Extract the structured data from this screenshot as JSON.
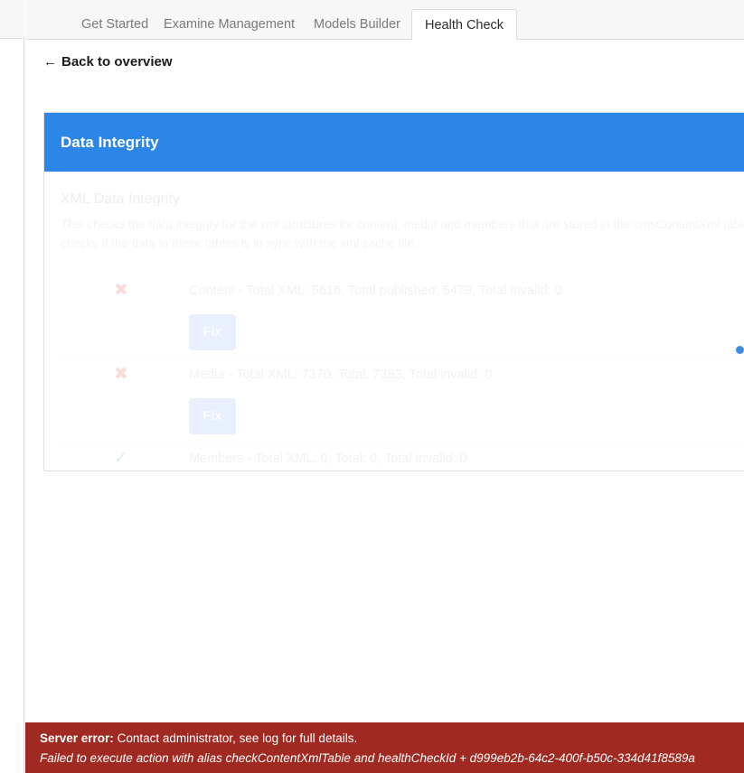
{
  "tabs": [
    {
      "label": "Get Started",
      "active": false
    },
    {
      "label": "Examine Management",
      "active": false
    },
    {
      "label": "Models Builder",
      "active": false
    },
    {
      "label": "Health Check",
      "active": true
    }
  ],
  "back_link": {
    "arrow": "←",
    "label": "Back to overview"
  },
  "card": {
    "header_title": "Data Integrity",
    "header_color": "#2b86e8",
    "section_heading": "XML Data Integrity",
    "section_description": "This checks the data integrity for the xml structures for content, media and members that are stored in the cmsContentXml table. This checks if the data in these tables is in sync with the xml cache file.",
    "checks": [
      {
        "status": "error",
        "status_icon": "cross-icon",
        "status_color": "#fadbdb",
        "message": "Content - Total XML: 5616, Total published: 5479, Total invalid: 0",
        "action_label": "Fix",
        "has_action": true
      },
      {
        "status": "error",
        "status_icon": "cross-icon",
        "status_color": "#fadbdb",
        "message": "Media - Total XML: 7370, Total: 7383, Total invalid: 0",
        "action_label": "Fix",
        "has_action": true
      },
      {
        "status": "ok",
        "status_icon": "check-icon",
        "status_color": "#daf0e3",
        "message": "Members - Total XML: 0, Total: 0, Total invalid: 0",
        "action_label": "",
        "has_action": false
      }
    ]
  },
  "loading": {
    "icon": "loading-dots-icon",
    "dot_colors": [
      "#3d8ce8",
      "#8bb9ef",
      "#1a73e8"
    ]
  },
  "error_banner": {
    "background": "#a02a21",
    "lead": "Server error:",
    "message": "Contact administrator, see log for full details.",
    "detail": "Failed to execute action with alias checkContentXmlTable and healthCheckId + d999eb2b-64c2-400f-b50c-334d41f8589a"
  }
}
